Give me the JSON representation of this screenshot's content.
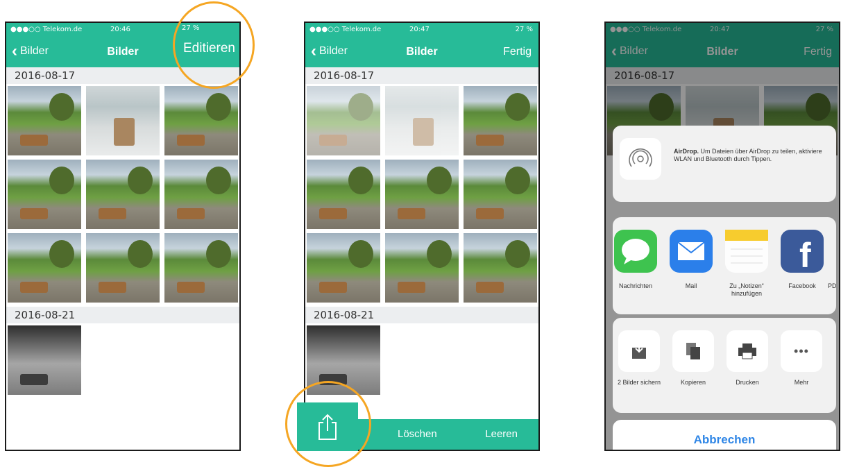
{
  "statusbar": {
    "carrier": "●●●○○ Telekom.de",
    "time1": "20:46",
    "time2": "20:47",
    "time3": "20:47",
    "battery": "27 %"
  },
  "nav": {
    "back": "Bilder",
    "title": "Bilder",
    "edit": "Editieren",
    "done": "Fertig"
  },
  "dates": {
    "first": "2016-08-17",
    "second": "2016-08-21"
  },
  "toolbar": {
    "delete": "Löschen",
    "clear": "Leeren"
  },
  "share": {
    "airdrop_title": "AirDrop.",
    "airdrop_text": "Um Dateien über AirDrop zu teilen, aktiviere WLAN und Bluetooth durch Tippen.",
    "apps": [
      "Nachrichten",
      "Mail",
      "Zu „Notizen“ hinzufügen",
      "Facebook",
      "PD"
    ],
    "actions": [
      "2 Bilder sichern",
      "Kopieren",
      "Drucken",
      "Mehr"
    ],
    "cancel": "Abbrechen"
  },
  "colors": {
    "accent": "#27bb98",
    "highlight": "#f5a623",
    "link": "#2f86e6"
  }
}
